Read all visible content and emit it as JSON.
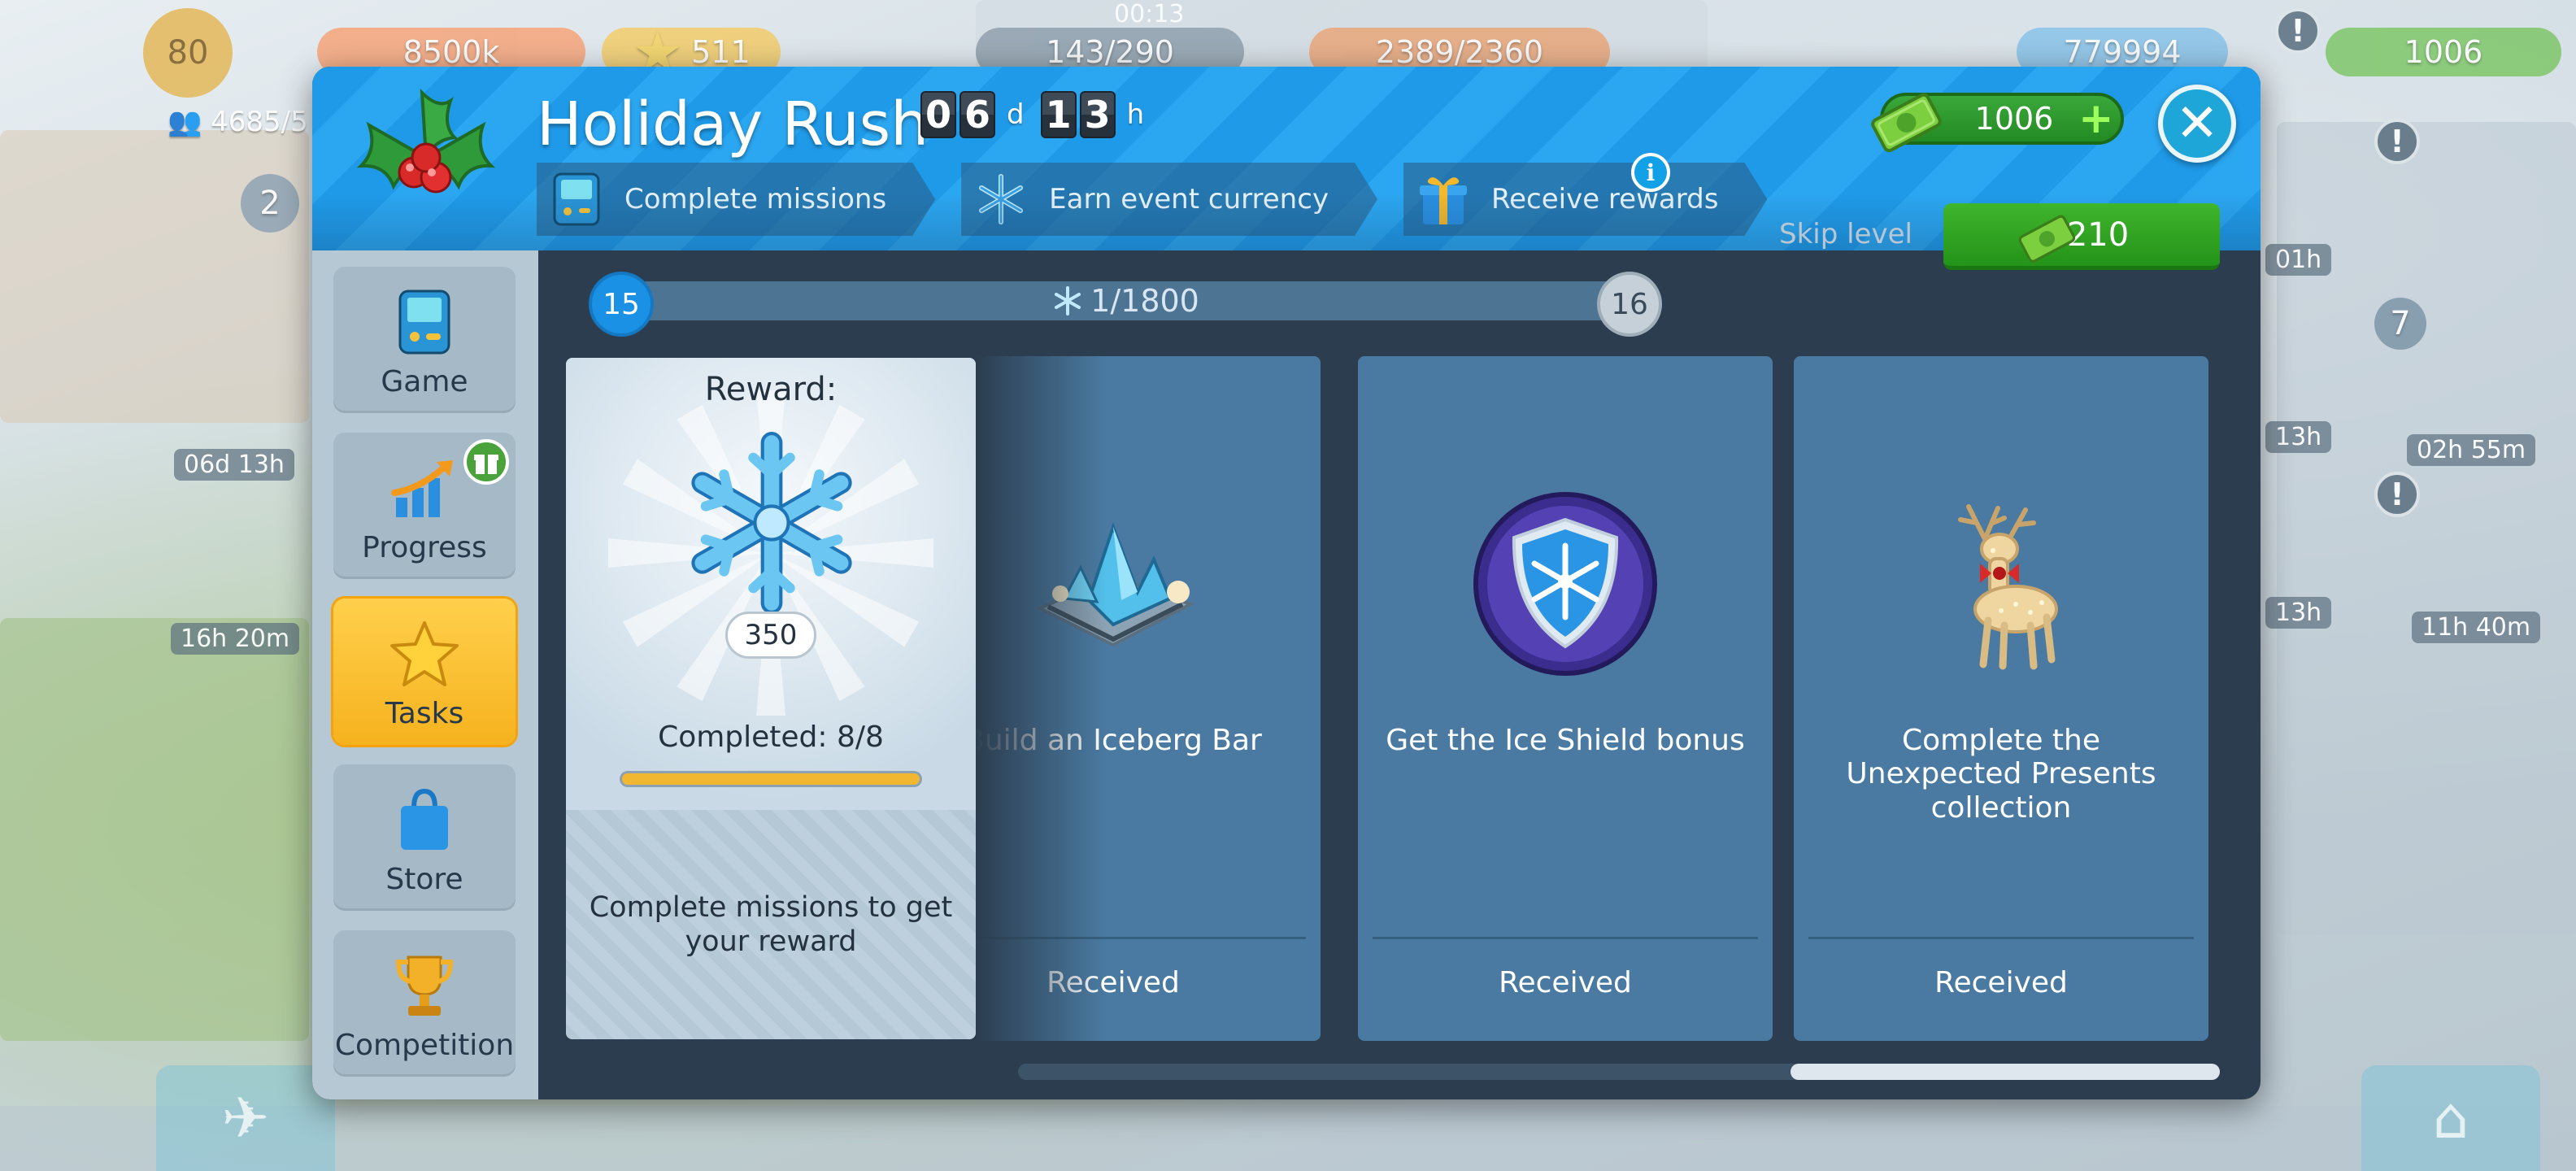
{
  "hud": {
    "level": "80",
    "coins": "8500k",
    "stars": "511",
    "clock": "00:13",
    "passengers": "143/290",
    "cargo": "2389/2360",
    "gold": "779994",
    "cash": "1006",
    "population": "4685/5",
    "wallet_badge": "2",
    "side_timers": [
      "06d 13h",
      "16h 20m"
    ],
    "right_timers": [
      "01h",
      "13h",
      "02h 55m",
      "13h",
      "11h 40m"
    ],
    "radar_badge": "7",
    "alert_glyph": "!"
  },
  "event": {
    "title": "Holiday Rush",
    "timer": {
      "days": [
        "0",
        "6"
      ],
      "day_unit": "d",
      "hours": [
        "1",
        "3"
      ],
      "hour_unit": "h"
    },
    "steps": [
      {
        "icon": "game-console-icon",
        "label": "Complete missions"
      },
      {
        "icon": "snowflake-icon",
        "label": "Earn event currency"
      },
      {
        "icon": "gift-icon",
        "label": "Receive rewards"
      }
    ],
    "info_glyph": "i",
    "cash": "1006",
    "plus_glyph": "+",
    "close_glyph": "✕"
  },
  "sidebar": {
    "items": [
      {
        "label": "Game",
        "icon": "game-console-icon",
        "active": false
      },
      {
        "label": "Progress",
        "icon": "progress-chart-icon",
        "active": false
      },
      {
        "label": "Tasks",
        "icon": "star-icon",
        "active": true
      },
      {
        "label": "Store",
        "icon": "shopping-bag-icon",
        "active": false
      },
      {
        "label": "Competition",
        "icon": "trophy-icon",
        "active": false
      }
    ]
  },
  "level_bar": {
    "current_level": "15",
    "next_level": "16",
    "progress_text": "1/1800",
    "progress_value": 1,
    "progress_max": 1800,
    "skip_label": "Skip level",
    "skip_cost": "210"
  },
  "reward": {
    "title": "Reward:",
    "amount": "350",
    "completed_text": "Completed: 8/8",
    "completed_fraction": 1.0,
    "hint": "Complete missions to get your reward"
  },
  "tasks": [
    {
      "icon": "iceberg-bar-icon",
      "text": "Build an Iceberg Bar",
      "status": "Received"
    },
    {
      "icon": "ice-shield-icon",
      "text": "Get the Ice Shield bonus",
      "status": "Received"
    },
    {
      "icon": "reindeer-icon",
      "text": "Complete the Unexpected Presents collection",
      "status": "Received"
    }
  ],
  "colors": {
    "header_blue": "#1f9ae8",
    "modal_bg": "#2b3d4e",
    "active_tab": "#f6b21e",
    "task_card": "#4a7aa1",
    "cash_green": "#2ea02e"
  }
}
